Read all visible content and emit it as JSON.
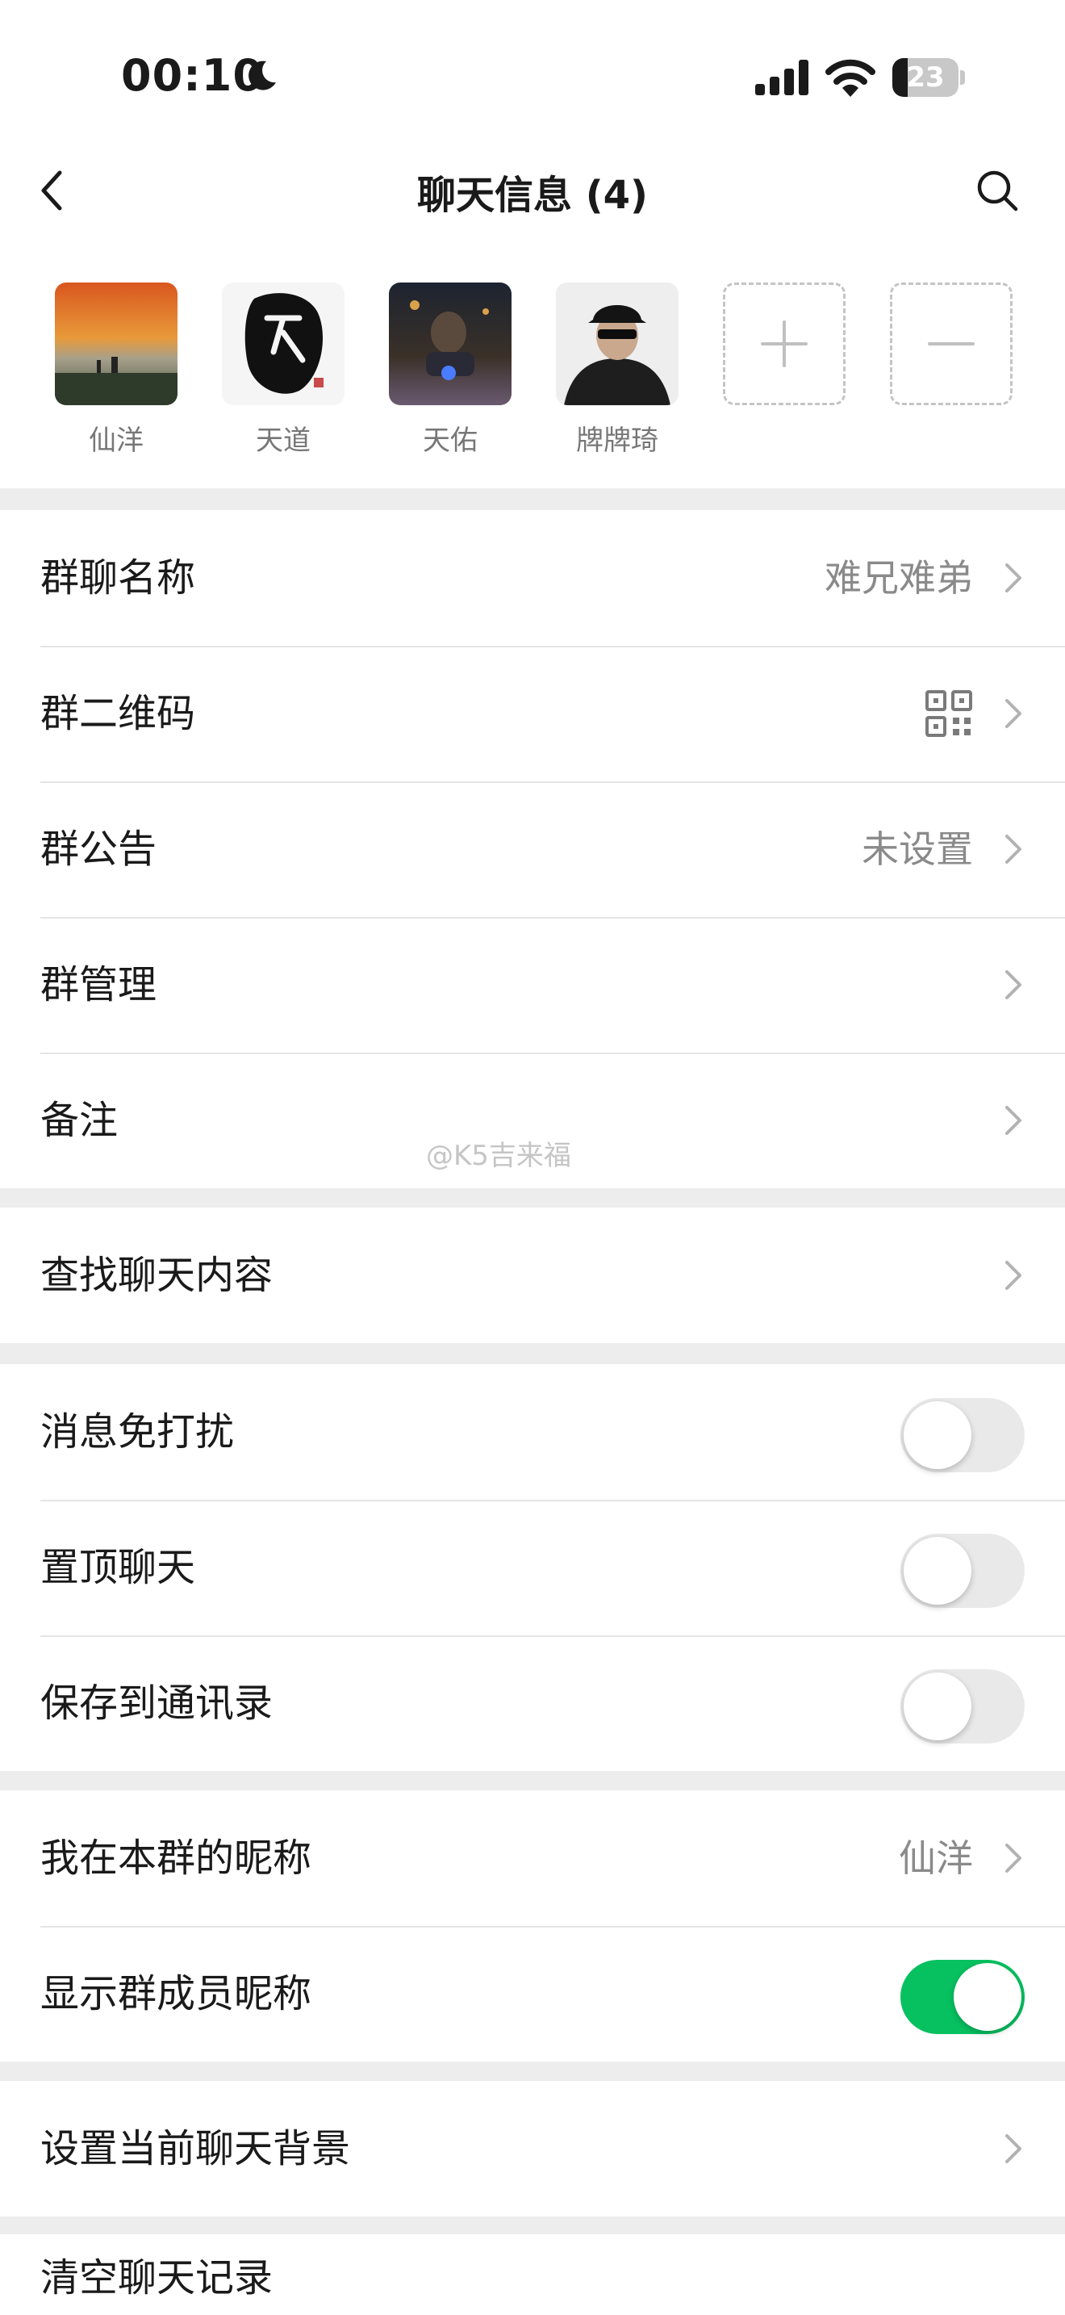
{
  "status_bar": {
    "time": "00:10",
    "battery_level": "23",
    "battery_fraction": 0.23
  },
  "nav": {
    "title": "聊天信息 (4)"
  },
  "members": [
    {
      "name": "仙洋",
      "avatar": "sunset-sea-photo"
    },
    {
      "name": "天道",
      "avatar": "ink-calligraphy"
    },
    {
      "name": "天佑",
      "avatar": "night-motorcycle-photo"
    },
    {
      "name": "牌牌琦",
      "avatar": "person-in-black-cap"
    }
  ],
  "group_section": {
    "name_label": "群聊名称",
    "name_value": "难兄难弟",
    "qrcode_label": "群二维码",
    "notice_label": "群公告",
    "notice_value": "未设置",
    "manage_label": "群管理",
    "remark_label": "备注"
  },
  "search_section": {
    "search_label": "查找聊天内容"
  },
  "toggle_section": {
    "mute_label": "消息免打扰",
    "mute_on": false,
    "pin_label": "置顶聊天",
    "pin_on": false,
    "save_label": "保存到通讯录",
    "save_on": false
  },
  "nickname_section": {
    "my_nickname_label": "我在本群的昵称",
    "my_nickname_value": "仙洋",
    "show_nicknames_label": "显示群成员昵称",
    "show_nicknames_on": true
  },
  "background_section": {
    "background_label": "设置当前聊天背景"
  },
  "clear_section": {
    "clear_label": "清空聊天记录"
  },
  "watermark": "@K5吉来福",
  "colors": {
    "accent_green": "#07c160",
    "page_background": "#ededed"
  }
}
